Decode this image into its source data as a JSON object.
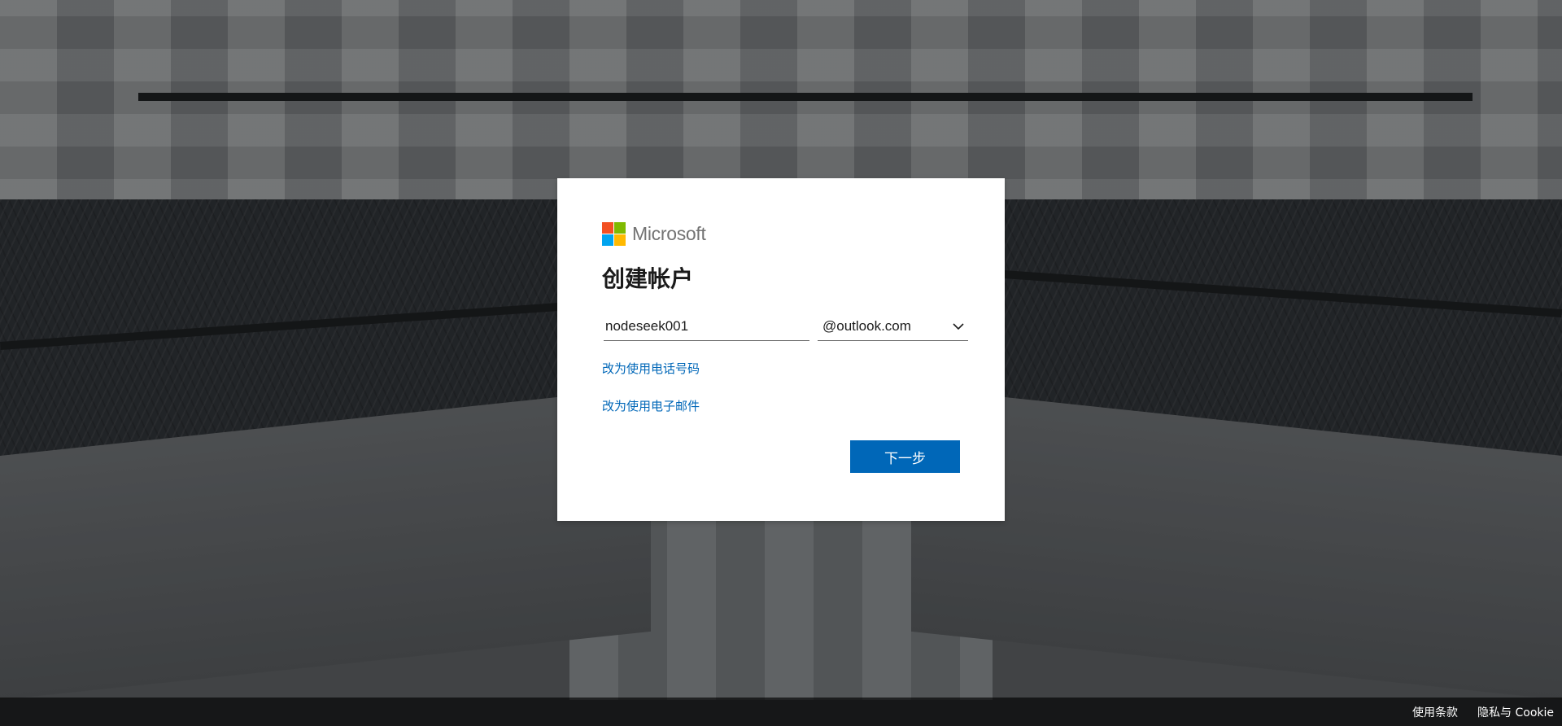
{
  "brand": {
    "name": "Microsoft",
    "colors": [
      "#f25022",
      "#7fba00",
      "#00a4ef",
      "#ffb900"
    ]
  },
  "dialog": {
    "title": "创建帐户",
    "username_value": "nodeseek001",
    "domain_selected": "@outlook.com",
    "link_phone": "改为使用电话号码",
    "link_email": "改为使用电子邮件",
    "next_button": "下一步"
  },
  "footer": {
    "terms": "使用条款",
    "privacy": "隐私与 Cookie"
  },
  "colors": {
    "accent": "#0067b8",
    "footer_bg": "#000000"
  }
}
